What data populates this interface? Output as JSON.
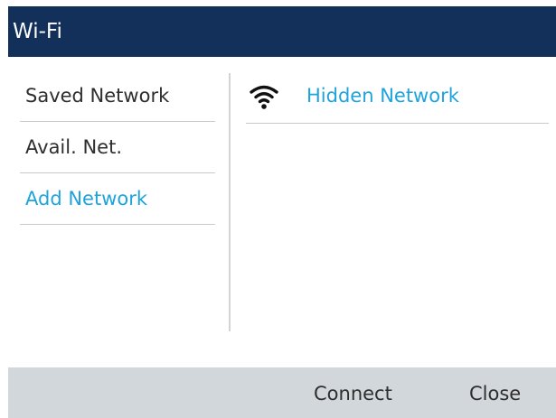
{
  "header": {
    "title": "Wi-Fi",
    "background_color": "#12305a"
  },
  "sidebar": {
    "items": [
      {
        "label": "Saved Network",
        "selected": false
      },
      {
        "label": "Avail. Net.",
        "selected": false
      },
      {
        "label": "Add Network",
        "selected": true
      }
    ]
  },
  "networks": [
    {
      "name": "Hidden Network",
      "icon": "wifi-icon"
    }
  ],
  "softkeys": {
    "connect_label": "Connect",
    "close_label": "Close"
  },
  "colors": {
    "accent": "#1fa3dc",
    "text": "#2e2e2e",
    "softkey_bar": "#d2d7db"
  }
}
